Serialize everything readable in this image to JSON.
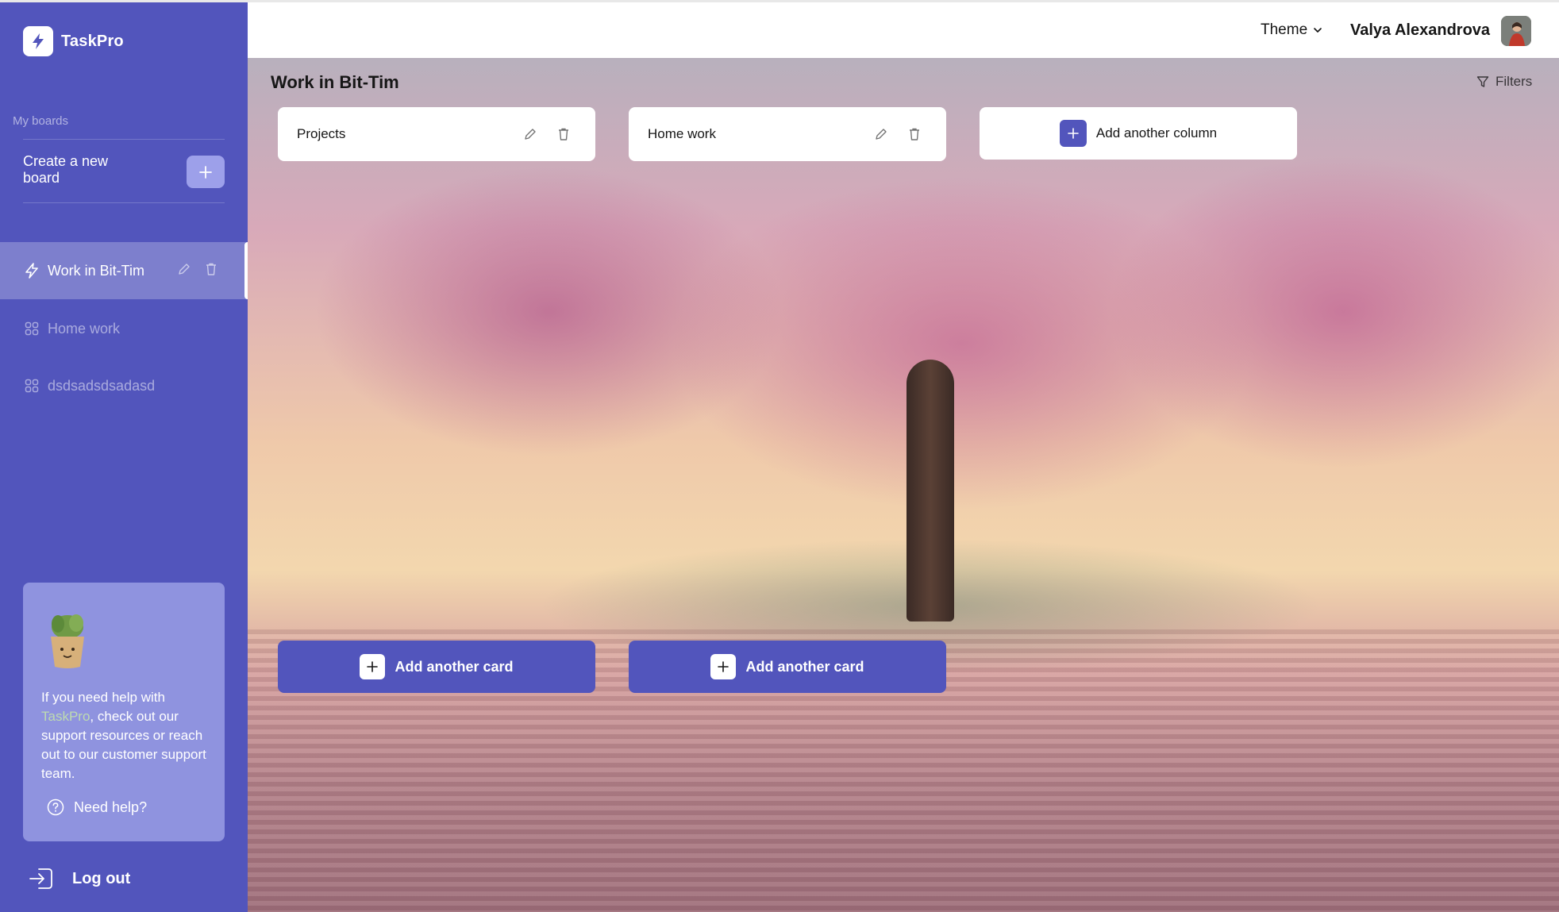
{
  "app": {
    "name": "TaskPro"
  },
  "sidebar": {
    "section_label": "My boards",
    "create_board_text": "Create a new board",
    "boards": [
      {
        "label": "Work in Bit-Tim",
        "active": true
      },
      {
        "label": "Home work",
        "active": false
      },
      {
        "label": "dsdsadsdsadasd",
        "active": false
      }
    ],
    "help": {
      "text_before": "If you need help with ",
      "text_accent": "TaskPro",
      "text_after": ", check out our support resources or reach out to our customer support team.",
      "button": "Need help?"
    },
    "logout": "Log out"
  },
  "header": {
    "theme_label": "Theme",
    "user_name": "Valya Alexandrova"
  },
  "board": {
    "title": "Work in Bit-Tim",
    "filters_label": "Filters",
    "columns": [
      {
        "title": "Projects",
        "add_card_label": "Add another card"
      },
      {
        "title": "Home work",
        "add_card_label": "Add another card"
      }
    ],
    "add_column_label": "Add another column"
  },
  "colors": {
    "brand": "#5255bc",
    "sidebar_help_bg": "#8f93df",
    "accent_green": "#bedbb0"
  }
}
